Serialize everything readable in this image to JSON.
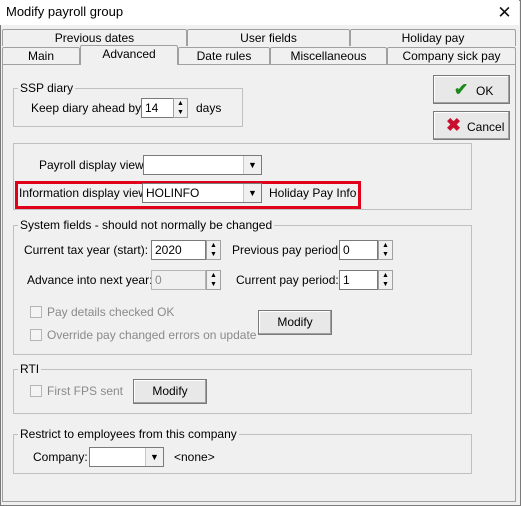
{
  "window": {
    "title": "Modify payroll group",
    "close_glyph": "✕"
  },
  "tabs_row1": [
    {
      "label": "Previous dates"
    },
    {
      "label": "User fields"
    },
    {
      "label": "Holiday pay"
    }
  ],
  "tabs_row2": [
    {
      "label": "Main"
    },
    {
      "label": "Advanced"
    },
    {
      "label": "Date rules"
    },
    {
      "label": "Miscellaneous"
    },
    {
      "label": "Company sick pay"
    }
  ],
  "active_tab": "Advanced",
  "ssp": {
    "group_label": "SSP diary",
    "keep_label": "Keep diary ahead by:",
    "keep_value": "14",
    "unit": "days"
  },
  "buttons": {
    "ok": "OK",
    "cancel": "Cancel"
  },
  "display": {
    "payroll_label": "Payroll display view:",
    "payroll_value": "",
    "info_label": "Information display view:",
    "info_value": "HOLINFO",
    "info_description": "Holiday Pay Info"
  },
  "system": {
    "group_label": "System fields - should not normally be changed",
    "tax_year_label": "Current tax year (start):",
    "tax_year_value": "2020",
    "prev_period_label": "Previous pay period:",
    "prev_period_value": "0",
    "advance_label": "Advance into next year:",
    "advance_value": "0",
    "current_period_label": "Current pay period:",
    "current_period_value": "1",
    "check1_label": "Pay details checked OK",
    "check2_label": "Override pay changed errors on update",
    "modify_label": "Modify"
  },
  "rti": {
    "group_label": "RTI",
    "check_label": "First FPS sent",
    "modify_label": "Modify"
  },
  "restrict": {
    "group_label": "Restrict to employees from this company",
    "company_label": "Company:",
    "company_value": "",
    "company_description": "<none>"
  },
  "colors": {
    "highlight": "#e0001a",
    "ok_check": "#1a8a1a",
    "cancel_x": "#c8102e"
  }
}
